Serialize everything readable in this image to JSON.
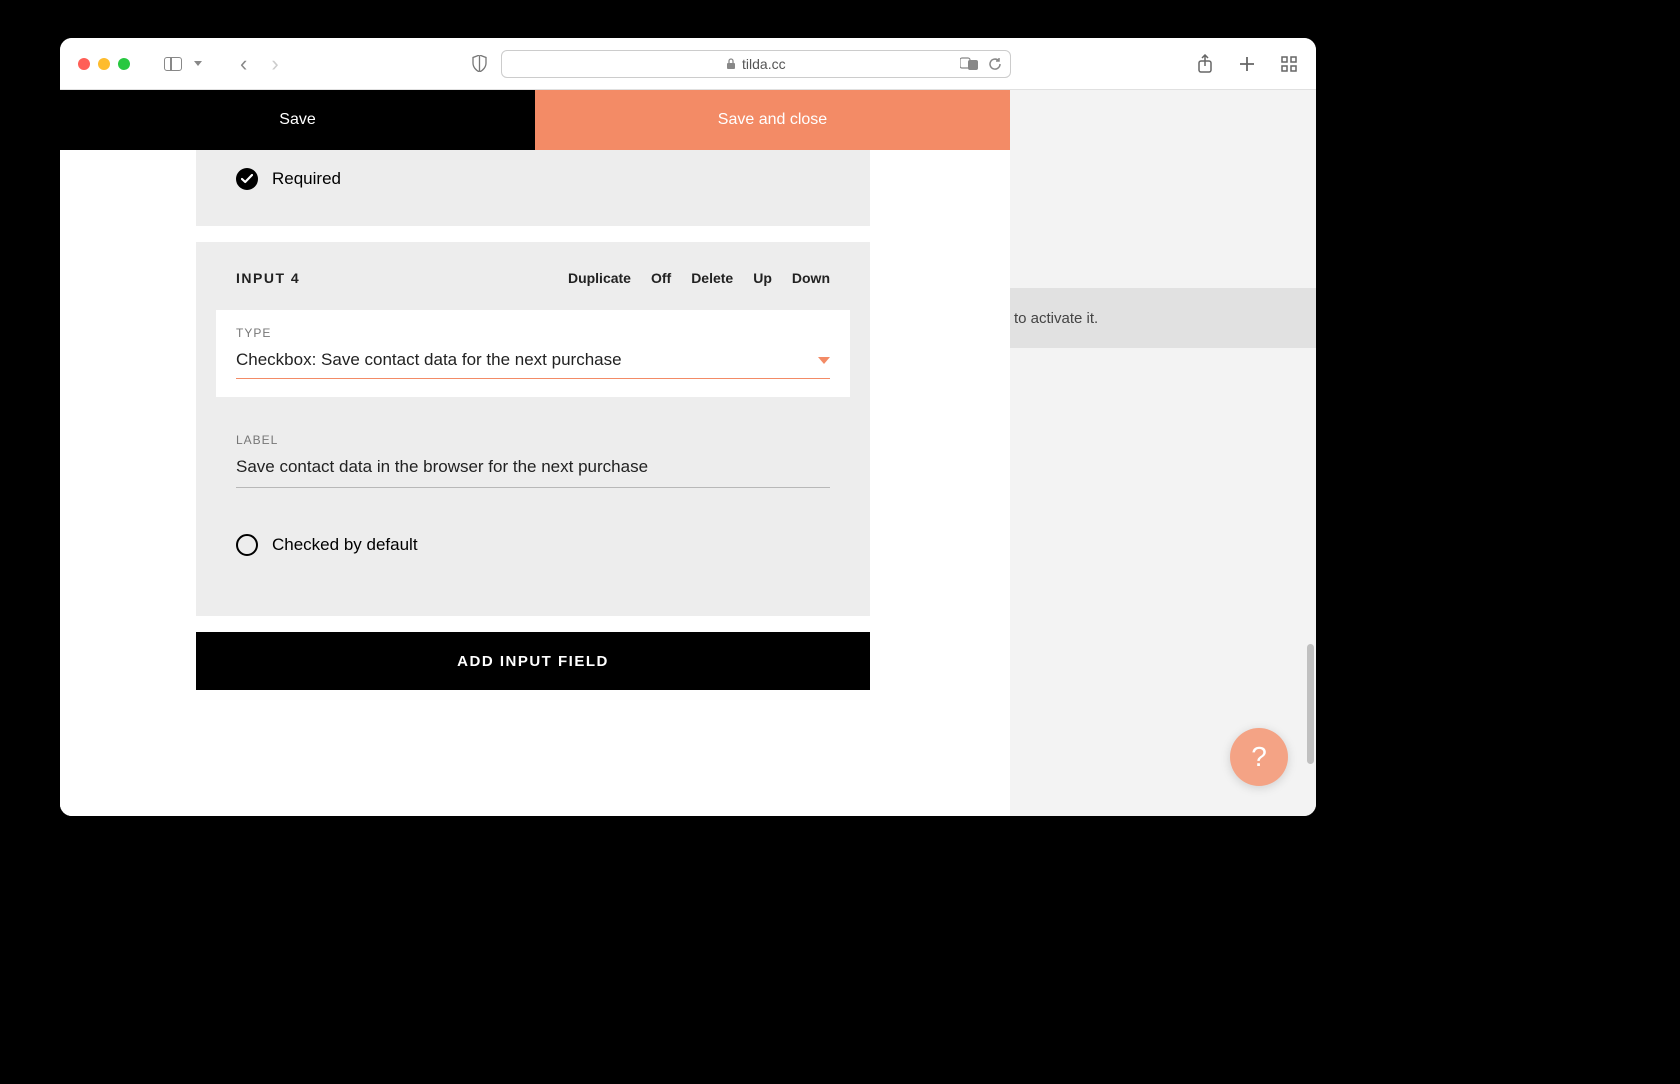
{
  "browser": {
    "url_host": "tilda.cc"
  },
  "actions": {
    "save": "Save",
    "save_close": "Save and close"
  },
  "card_prev": {
    "required_label": "Required"
  },
  "card_input4": {
    "title": "INPUT 4",
    "toolbar": {
      "duplicate": "Duplicate",
      "off": "Off",
      "delete": "Delete",
      "up": "Up",
      "down": "Down"
    },
    "type_label": "TYPE",
    "type_value": "Checkbox: Save contact data for the next purchase",
    "label_label": "LABEL",
    "label_value": "Save contact data in the browser for the next purchase",
    "checked_default_label": "Checked by default"
  },
  "add_button": "ADD INPUT FIELD",
  "right": {
    "activate_fragment": "to activate it."
  },
  "help_symbol": "?"
}
